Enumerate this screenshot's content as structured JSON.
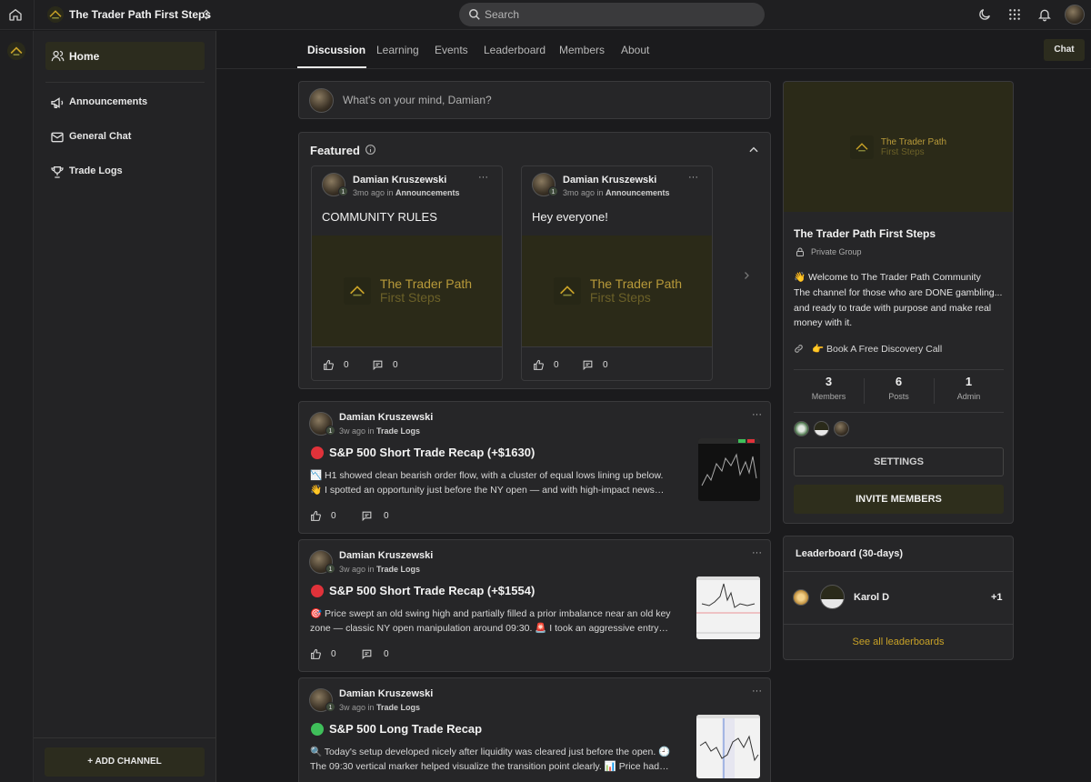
{
  "topbar": {
    "group_name": "The Trader Path First Steps",
    "search_placeholder": "Search"
  },
  "sidebar": {
    "items": [
      {
        "label": "Home",
        "icon": "users-icon"
      },
      {
        "label": "Announcements",
        "icon": "megaphone-icon"
      },
      {
        "label": "General Chat",
        "icon": "mail-icon"
      },
      {
        "label": "Trade Logs",
        "icon": "trophy-icon"
      }
    ],
    "add_channel_label": "+ ADD CHANNEL"
  },
  "tabs": [
    {
      "label": "Discussion"
    },
    {
      "label": "Learning"
    },
    {
      "label": "Events"
    },
    {
      "label": "Leaderboard"
    },
    {
      "label": "Members"
    },
    {
      "label": "About"
    }
  ],
  "chat_label": "Chat",
  "composer": {
    "placeholder": "What's on your mind, Damian?"
  },
  "featured": {
    "title": "Featured",
    "logo_line1": "The Trader Path",
    "logo_line2": "First Steps",
    "cards": [
      {
        "author": "Damian Kruszewski",
        "time": "3mo ago in",
        "channel": "Announcements",
        "title": "COMMUNITY RULES",
        "likes": "0",
        "comments": "0"
      },
      {
        "author": "Damian Kruszewski",
        "time": "3mo ago in",
        "channel": "Announcements",
        "title": "Hey everyone!",
        "likes": "0",
        "comments": "0"
      }
    ]
  },
  "posts": [
    {
      "author": "Damian Kruszewski",
      "time": "3w ago in",
      "channel": "Trade Logs",
      "title": "S&P 500 Short Trade Recap (+$1630)",
      "line1": "📉 H1 showed clean bearish order flow, with a cluster of equal lows lining up below.",
      "line2": "👋 I spotted an opportunity just before the NY open — and with high-impact news…",
      "likes": "0",
      "comments": "0",
      "status_color": "#e0323a"
    },
    {
      "author": "Damian Kruszewski",
      "time": "3w ago in",
      "channel": "Trade Logs",
      "title": "S&P 500 Short Trade Recap (+$1554)",
      "line1": "🎯 Price swept an old swing high and partially filled a prior imbalance near an old key",
      "line2": "zone — classic NY open manipulation around 09:30. 🚨 I took an aggressive entry…",
      "likes": "0",
      "comments": "0",
      "status_color": "#e0323a"
    },
    {
      "author": "Damian Kruszewski",
      "time": "3w ago in",
      "channel": "Trade Logs",
      "title": "S&P 500 Long Trade Recap",
      "line1": "🔍 Today's setup developed nicely after liquidity was cleared just before the open. 🕘",
      "line2": "The 09:30 vertical marker helped visualize the transition point clearly. 📊 Price had…",
      "likes": "",
      "comments": "",
      "status_color": "#3fbf5a"
    }
  ],
  "about": {
    "name": "The Trader Path First Steps",
    "privacy": "Private Group",
    "welcome": "👋 Welcome to The Trader Path Community",
    "desc": "The channel for those who are DONE gambling... and ready to trade with purpose and make real money with it.",
    "link": "👉 Book A Free Discovery Call",
    "stats": [
      {
        "value": "3",
        "label": "Members"
      },
      {
        "value": "6",
        "label": "Posts"
      },
      {
        "value": "1",
        "label": "Admin"
      }
    ],
    "settings_label": "SETTINGS",
    "invite_label": "INVITE MEMBERS"
  },
  "leaderboard": {
    "title": "Leaderboard (30-days)",
    "entries": [
      {
        "name": "Karol D",
        "score": "+1"
      }
    ],
    "see_all": "See all leaderboards"
  },
  "colors": {
    "accent_gold": "#c9a227",
    "button_olive": "#2e2e1c",
    "bg": "#1b1b1d"
  }
}
